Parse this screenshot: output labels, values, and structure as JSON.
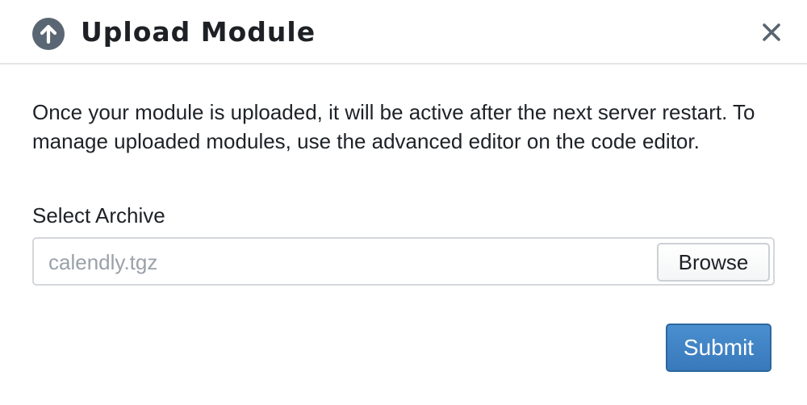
{
  "dialog": {
    "title": "Upload Module",
    "header_icon": "arrow-up-circle-icon",
    "close_icon": "close-icon",
    "description": "Once your module is uploaded, it will be active after the next server restart. To manage uploaded modules, use the advanced editor on the code editor.",
    "archive_label": "Select Archive",
    "file_name": "calendly.tgz",
    "browse_label": "Browse",
    "submit_label": "Submit"
  },
  "colors": {
    "header_icon": "#5a6673",
    "accent": "#3d7fc1",
    "accent_border": "#2d679e",
    "placeholder_text": "#9aa1a9",
    "divider": "#e3e5e8"
  }
}
